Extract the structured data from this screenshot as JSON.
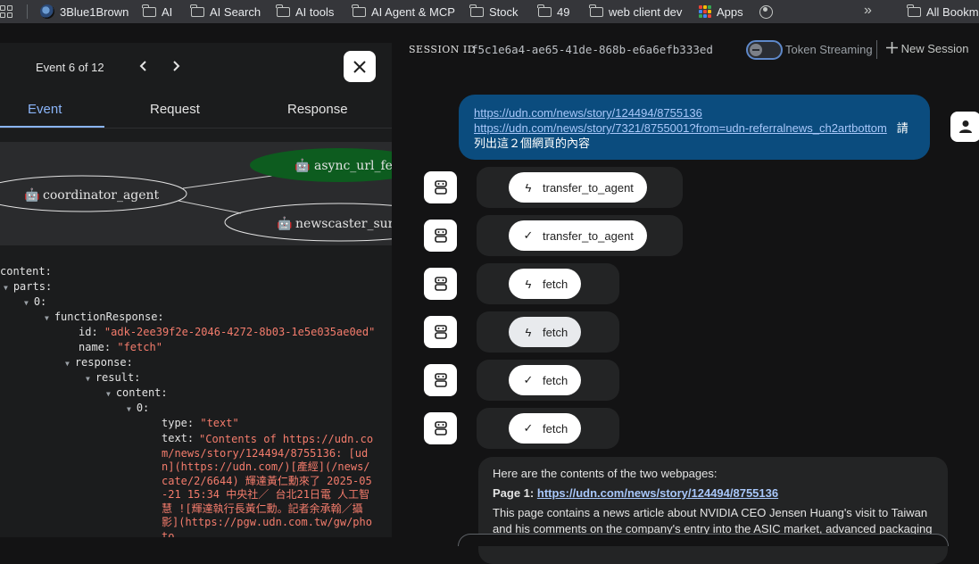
{
  "bookmarks": {
    "items": [
      {
        "label": "3Blue1Brown",
        "icon": "3blue1brown-icon"
      },
      {
        "label": "AI",
        "icon": "folder-icon"
      },
      {
        "label": "AI Search",
        "icon": "folder-icon"
      },
      {
        "label": "AI tools",
        "icon": "folder-icon"
      },
      {
        "label": "AI Agent & MCP",
        "icon": "folder-icon"
      },
      {
        "label": "Stock",
        "icon": "folder-icon"
      },
      {
        "label": "49",
        "icon": "folder-icon"
      },
      {
        "label": "web client dev",
        "icon": "folder-icon"
      },
      {
        "label": "Apps",
        "icon": "apps-grid-icon"
      },
      {
        "label": "",
        "icon": "globe-icon"
      }
    ],
    "more": "»",
    "all_bookmarks": "All Bookm"
  },
  "event_panel": {
    "counter": "Event 6 of 12",
    "prev": "‹",
    "next": "›",
    "close": "✕",
    "tabs": [
      "Event",
      "Request",
      "Response"
    ],
    "active_tab": "Event",
    "graph": {
      "nodes": [
        "coordinator_agent",
        "async_url_fe",
        "newscaster_sum"
      ],
      "highlight_node": "async_url_fe",
      "highlight_color": "#0d5c1f"
    },
    "tree": {
      "content_key": "content:",
      "parts_key": "parts:",
      "idx0": "0:",
      "function_response_key": "functionResponse:",
      "id_key": "id:",
      "id_value": "\"adk-2ee39f2e-2046-4272-8b03-1e5e035ae0ed\"",
      "name_key": "name:",
      "name_value": "\"fetch\"",
      "response_key": "response:",
      "result_key": "result:",
      "inner_content_key": "content:",
      "inner_idx0": "0:",
      "type_key": "type:",
      "type_value": "\"text\"",
      "text_key": "text:",
      "text_value": "\"Contents of https://udn.com/news/story/124494/8755136: [udn](https://udn.com/)[產經](/news/cate/2/6644) 輝達黃仁勳來了 2025-05-21 15:34 中央社／ 台北21日電 人工智慧 ![輝達執行長黃仁勳。記者余承翰／攝影](https://pgw.udn.com.tw/gw/photo."
    }
  },
  "session": {
    "label": "SESSION ID",
    "id": "f5c1e6a4-ae65-41de-868b-e6a6efb333ed",
    "token_streaming_label": "Token Streaming",
    "new_session_label": "New Session"
  },
  "chat": {
    "user_message": {
      "link1": "https://udn.com/news/story/124494/8755136",
      "link2": "https://udn.com/news/story/7321/8755001?from=udn-referralnews_ch2artbottom",
      "tail_char": "請",
      "text": "列出這２個網頁的內容"
    },
    "tool_calls": [
      {
        "label": "transfer_to_agent",
        "icon": "lightning-icon",
        "glyph": "ϟ"
      },
      {
        "label": "transfer_to_agent",
        "icon": "check-icon",
        "glyph": "✓"
      },
      {
        "label": "fetch",
        "icon": "lightning-icon",
        "glyph": "ϟ"
      },
      {
        "label": "fetch",
        "icon": "lightning-icon",
        "glyph": "ϟ"
      },
      {
        "label": "fetch",
        "icon": "check-icon",
        "glyph": "✓"
      },
      {
        "label": "fetch",
        "icon": "check-icon",
        "glyph": "✓"
      }
    ],
    "reply": {
      "intro": "Here are the contents of the two webpages:",
      "page1_label": "Page 1:",
      "page1_link": "https://udn.com/news/story/124494/8755136",
      "body": "This page contains a news article about NVIDIA CEO Jensen Huang's visit to Taiwan and his comments on the company's entry into the ASIC market, advanced packaging"
    }
  }
}
